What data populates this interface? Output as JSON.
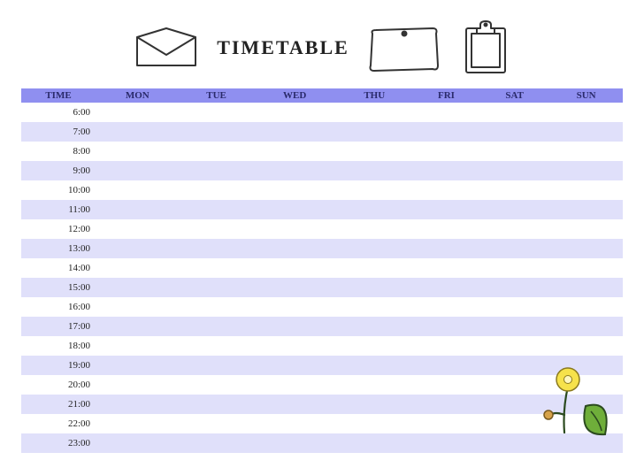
{
  "title": "TIMETABLE",
  "columns": [
    "TIME",
    "MON",
    "TUE",
    "WED",
    "THU",
    "FRI",
    "SAT",
    "SUN"
  ],
  "times": [
    "6:00",
    "7:00",
    "8:00",
    "9:00",
    "10:00",
    "11:00",
    "12:00",
    "13:00",
    "14:00",
    "15:00",
    "16:00",
    "17:00",
    "18:00",
    "19:00",
    "20:00",
    "21:00",
    "22:00",
    "23:00"
  ]
}
